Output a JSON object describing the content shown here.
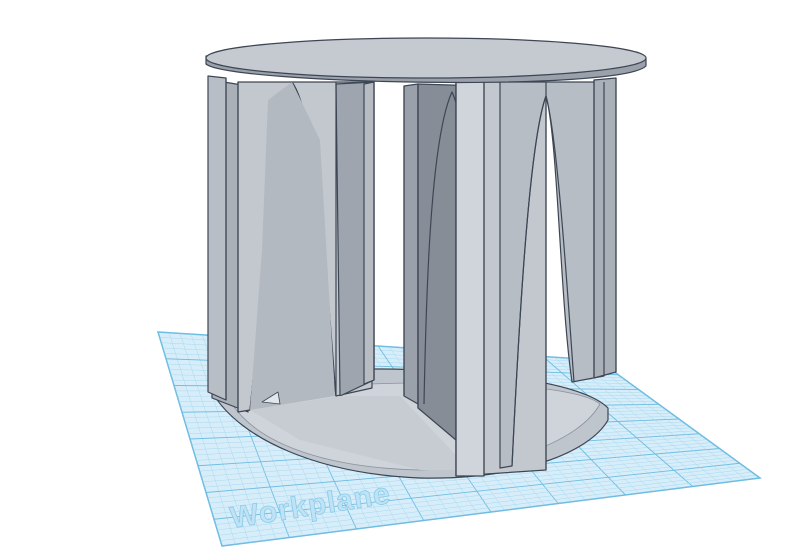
{
  "viewport": {
    "workplane_label": "Workplane"
  },
  "colors": {
    "background": "#ffffff",
    "workplane_fill": "#d7eefa",
    "workplane_grid_minor": "#a9d8ef",
    "workplane_grid_major": "#6fbde2",
    "model_light": "#c3c8cf",
    "model_mid": "#aab0b8",
    "model_dark": "#8c939c",
    "model_edge": "#3d4654"
  },
  "scene": {
    "object": "hollow-cylinder-with-vanes",
    "grid_visible": true
  }
}
